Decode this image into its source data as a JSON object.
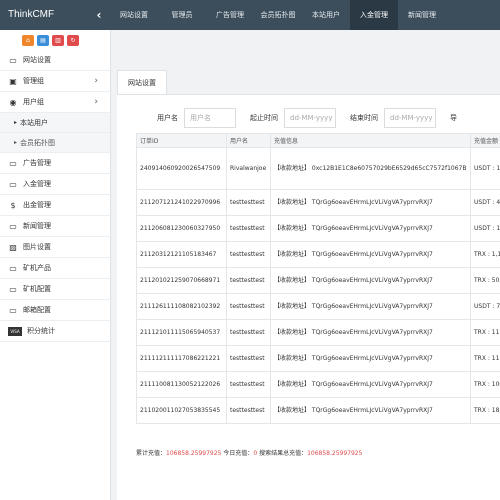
{
  "app": {
    "brand": "ThinkCMF",
    "collapse_icon": "chevron-left-icon"
  },
  "nav": {
    "items": [
      "网站设置",
      "管理员",
      "广告管理",
      "会员拓扑图",
      "本站用户",
      "入金管理",
      "新闻管理"
    ],
    "active_index": 5
  },
  "quick_actions": [
    "home-icon",
    "doc-icon",
    "trash-icon",
    "refresh-icon"
  ],
  "sidebar": {
    "items": [
      {
        "label": "网站设置",
        "icon": "monitor-icon"
      },
      {
        "label": "管理组",
        "icon": "group-icon",
        "arrow": "›"
      },
      {
        "label": "用户组",
        "icon": "user-icon",
        "arrow": "›"
      }
    ],
    "sub_items": [
      "本站用户",
      "会员拓扑图"
    ],
    "items_after": [
      {
        "label": "广告管理",
        "icon": "monitor-icon"
      },
      {
        "label": "入金管理",
        "icon": "monitor-icon"
      },
      {
        "label": "出金管理",
        "icon": "dollar-icon"
      },
      {
        "label": "新闻管理",
        "icon": "monitor-icon"
      },
      {
        "label": "图片设置",
        "icon": "image-icon"
      },
      {
        "label": "矿机产品",
        "icon": "monitor-icon"
      },
      {
        "label": "矿机配置",
        "icon": "monitor-icon"
      },
      {
        "label": "邮箱配置",
        "icon": "monitor-icon"
      },
      {
        "label": "积分统计",
        "icon": "visa-icon"
      }
    ]
  },
  "tab": {
    "label": "网站设置"
  },
  "filters": {
    "username_label": "用户名",
    "username_placeholder": "用户名",
    "start_label": "起止时间",
    "start_placeholder": "dd-MM-yyyy",
    "end_label": "结束时间",
    "end_placeholder": "dd-MM-yyyy",
    "more_label": "导"
  },
  "table": {
    "headers": [
      "订单ID",
      "用户名",
      "充值信息",
      "充值金额"
    ],
    "rows": [
      [
        "24091406092002654750​9",
        "Rivalwanjoe",
        "【收款地址】 0xc12B1E1C8e60757029bE6529d65cC7572f1067B",
        "USDT : 1,"
      ],
      [
        "2112071212410229709​96",
        "testtesttest",
        "【收款地址】 TQrGg6oeavEHrmLJcVLiVgVA7yprrvRXJ7",
        "USDT : 44"
      ],
      [
        "21120608123006032795​0",
        "testtesttest",
        "【收款地址】 TQrGg6oeavEHrmLJcVLiVgVA7yprrvRXJ7",
        "USDT : 10"
      ],
      [
        "2112031212110518346​7",
        "testtesttest",
        "【收款地址】 TQrGg6oeavEHrmLJcVLiVgVA7yprrvRXJ7",
        "TRX : 1,111,111"
      ],
      [
        "2112010212590706689​71",
        "testtesttest",
        "【收款地址】 TQrGg6oeavEHrmLJcVLiVgVA7yprrvRXJ7",
        "TRX : 50,"
      ],
      [
        "2111261111080821023​92",
        "testtesttest",
        "【收款地址】 TQrGg6oeavEHrmLJcVLiVgVA7yprrvRXJ7",
        "USDT : 7,"
      ],
      [
        "2111210111150659405​37",
        "testtesttest",
        "【收款地址】 TQrGg6oeavEHrmLJcVLiVgVA7yprrvRXJ7",
        "TRX : 111"
      ],
      [
        "21111211111708622122​1",
        "testtesttest",
        "【收款地址】 TQrGg6oeavEHrmLJcVLiVgVA7yprrvRXJ7",
        "TRX : 111"
      ],
      [
        "2111100811300521220​26",
        "testtesttest",
        "【收款地址】 TQrGg6oeavEHrmLJcVLiVgVA7yprrvRXJ7",
        "TRX : 100"
      ],
      [
        "2110200110270538355​45",
        "testtesttest",
        "【收款地址】 TQrGg6oeavEHrmLJcVLiVgVA7yprrvRXJ7",
        "TRX : 18,"
      ]
    ]
  },
  "summary": {
    "total_label": "累计充值：",
    "total_value": "106858.25997925",
    "today_label": "今日充值：",
    "today_value": "0",
    "search_label": "搜索结果总充值：",
    "search_value": "106858.25997925"
  },
  "colors": {
    "topbar": "#3c4e5c",
    "active_nav": "#2a3944",
    "accent_red": "#e04b4b"
  }
}
